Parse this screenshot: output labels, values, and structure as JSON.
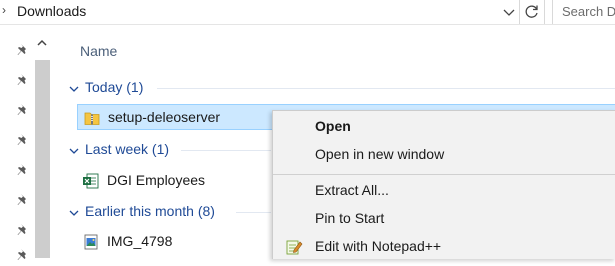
{
  "address_bar": {
    "path": "Downloads",
    "search_placeholder": "Search D"
  },
  "file_list": {
    "column_name": "Name",
    "groups": [
      {
        "label": "Today (1)",
        "files": [
          {
            "name": "setup-deleoserver",
            "icon": "zip-folder-icon",
            "selected": true
          }
        ]
      },
      {
        "label": "Last week (1)",
        "files": [
          {
            "name": "DGI Employees",
            "icon": "excel-icon",
            "selected": false
          }
        ]
      },
      {
        "label": "Earlier this month (8)",
        "files": [
          {
            "name": "IMG_4798",
            "icon": "image-icon",
            "selected": false
          }
        ]
      }
    ]
  },
  "context_menu": {
    "items": [
      {
        "label": "Open",
        "bold": true
      },
      {
        "label": "Open in new window"
      },
      {
        "label": "Extract All..."
      },
      {
        "label": "Pin to Start"
      },
      {
        "label": "Edit with Notepad++",
        "icon": "notepad-plus-plus-icon"
      }
    ]
  },
  "colors": {
    "selection_fill": "#cce8ff",
    "selection_border": "#99d1ff",
    "group_header": "#1f4a96",
    "menu_background": "#f2f2f2"
  }
}
